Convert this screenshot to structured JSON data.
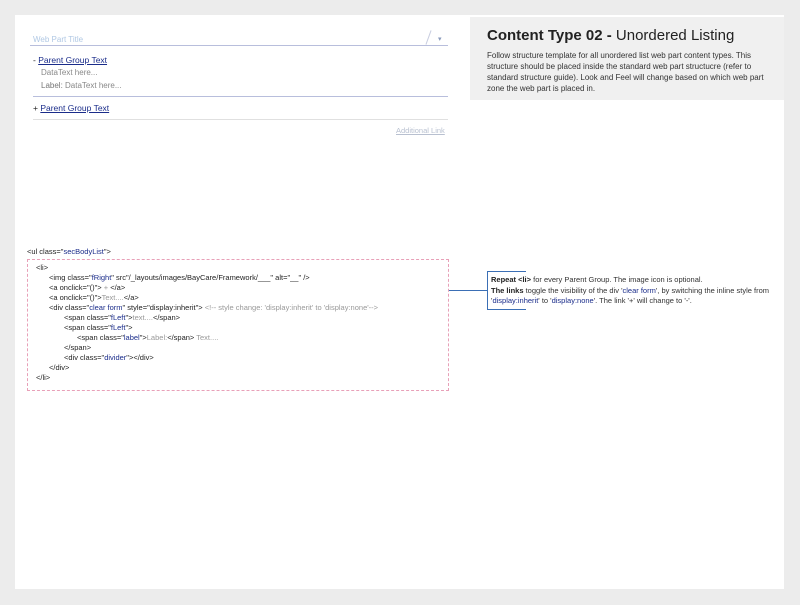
{
  "info": {
    "title_bold": "Content Type 02 -",
    "title_rest": " Unordered Listing",
    "description": "Follow structure template for all unordered list web part content types. This structure should be placed inside the standard web part structucre (refer to standard structure guide). Look and Feel will change based on which web part zone the web part is placed in."
  },
  "webpart": {
    "title": "Web Part Title",
    "arrow_icon": "chevron-down-icon",
    "group1_prefix": "- ",
    "group1_link": "Parent Group Text",
    "data1": "DataText here...",
    "data2_label": "Label:",
    "data2_text": " DataText here...",
    "group2_prefix": "+ ",
    "group2_link": "Parent Group Text",
    "additional_link": "Additional Link"
  },
  "code": {
    "ul_open_a": "<ul class=\"",
    "ul_class": "secBodyList",
    "ul_open_b": "\">",
    "li_open": "<li>",
    "img_a": "<img class=\"",
    "img_class": "fRight",
    "img_b": "\" src\"/_layouts/images/BayCare/Framework/___\" alt=\"__\" />",
    "a1_a": "<a onclick=\"()\"> ",
    "a1_text": "+",
    "a1_b": " </a>",
    "a2_a": "<a onclick=\"()\">",
    "a2_text": "Text....",
    "a2_b": "</a>",
    "div_a": "<div class=\"",
    "div_class": "clear form",
    "div_b": "\" style=\"display:inherit\"> ",
    "div_comment": "<!-- style change: 'display:inherit' to 'display:none'-->",
    "span1_a": "<span class=\"",
    "span1_class": "fLeft",
    "span1_b": "\">",
    "span1_text": "text....",
    "span1_c": "</span>",
    "span2_a": "<span class=\"",
    "span2_class": "fLeft",
    "span2_b": "\">",
    "span3_a": "<span class=\"",
    "span3_class": "label",
    "span3_b": "\">",
    "span3_text": "Label:",
    "span3_c": "</span> ",
    "span3_after": "Text....",
    "span_close": "</span>",
    "divider_a": "<div class=\"",
    "divider_class": "divider",
    "divider_b": "\"></div>",
    "div_close": "</div>",
    "li_close": "</li>"
  },
  "annotation": {
    "l1_bold": "Repeat <li>",
    "l1_rest": " for every Parent Group. The image icon is optional.",
    "l2_bold": "The links",
    "l2_a": " toggle the visibility of the div '",
    "l2_v1": "clear form",
    "l2_b": "', by switching the inline style from '",
    "l2_v2": "display:inherit",
    "l2_c": "' to '",
    "l2_v3": "display:none",
    "l2_d": "'. The link '+' will change to '-'."
  }
}
